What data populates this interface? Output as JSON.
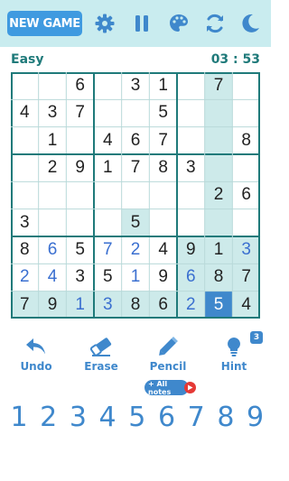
{
  "header": {
    "new_game_label": "NEW GAME",
    "icons": [
      "gear-icon",
      "pause-icon",
      "palette-icon",
      "refresh-icon",
      "moon-icon"
    ]
  },
  "status": {
    "difficulty": "Easy",
    "timer": "03 : 53"
  },
  "board": {
    "rows": [
      [
        "",
        "",
        "6",
        "",
        "3",
        "1",
        "",
        "7",
        ""
      ],
      [
        "4",
        "3",
        "7",
        "",
        "",
        "5",
        "",
        "",
        ""
      ],
      [
        "",
        "1",
        "",
        "4",
        "6",
        "7",
        "",
        "",
        "8"
      ],
      [
        "",
        "2",
        "9",
        "1",
        "7",
        "8",
        "3",
        "",
        ""
      ],
      [
        "",
        "",
        "",
        "",
        "",
        "",
        "",
        "2",
        "6"
      ],
      [
        "3",
        "",
        "",
        "",
        "5",
        "",
        "",
        "",
        ""
      ],
      [
        "8",
        "6",
        "5",
        "7",
        "2",
        "4",
        "9",
        "1",
        "3"
      ],
      [
        "2",
        "4",
        "3",
        "5",
        "1",
        "9",
        "6",
        "8",
        "7"
      ],
      [
        "7",
        "9",
        "1",
        "3",
        "8",
        "6",
        "2",
        "5",
        "4"
      ]
    ],
    "user_entered": [
      [
        6,
        1
      ],
      [
        6,
        3
      ],
      [
        6,
        4
      ],
      [
        6,
        8
      ],
      [
        7,
        0
      ],
      [
        7,
        1
      ],
      [
        7,
        4
      ],
      [
        7,
        6
      ],
      [
        8,
        2
      ],
      [
        8,
        3
      ],
      [
        8,
        6
      ]
    ],
    "selected_cell": [
      8,
      7
    ],
    "highlighted": [
      [
        0,
        7
      ],
      [
        1,
        7
      ],
      [
        2,
        7
      ],
      [
        3,
        7
      ],
      [
        4,
        7
      ],
      [
        5,
        7
      ],
      [
        6,
        7
      ],
      [
        7,
        7
      ],
      [
        6,
        6
      ],
      [
        6,
        8
      ],
      [
        7,
        6
      ],
      [
        7,
        8
      ],
      [
        8,
        6
      ],
      [
        8,
        8
      ],
      [
        8,
        0
      ],
      [
        8,
        1
      ],
      [
        8,
        2
      ],
      [
        8,
        3
      ],
      [
        8,
        4
      ],
      [
        8,
        5
      ],
      [
        5,
        4
      ]
    ]
  },
  "tools": [
    {
      "label": "Undo",
      "icon": "undo-icon"
    },
    {
      "label": "Erase",
      "icon": "eraser-icon"
    },
    {
      "label": "Pencil",
      "icon": "pencil-icon"
    },
    {
      "label": "Hint",
      "icon": "lightbulb-icon"
    }
  ],
  "hint_count": "3",
  "all_notes_label": "+ All notes",
  "numpad": [
    "1",
    "2",
    "3",
    "4",
    "5",
    "6",
    "7",
    "8",
    "9"
  ],
  "colors": {
    "accent": "#3f88cc",
    "topbar": "#c9ecef",
    "highlight": "#cdeaea",
    "grid_line": "#1f7a7a",
    "user_digit": "#3a6fd0"
  }
}
